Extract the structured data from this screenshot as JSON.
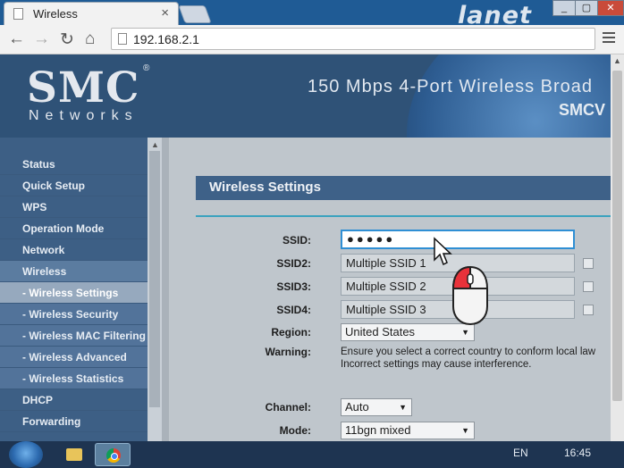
{
  "browser": {
    "tab_title": "Wireless",
    "tab_close": "×",
    "url": "192.168.2.1",
    "brand_watermark": "lanet",
    "nav": {
      "back": "←",
      "forward": "→",
      "reload": "↻",
      "home": "⌂"
    }
  },
  "header": {
    "logo": "SMC",
    "logo_reg": "®",
    "logo_sub": "Networks",
    "title": "150 Mbps 4-Port Wireless Broad",
    "model": "SMCV"
  },
  "sidebar": {
    "items": [
      {
        "label": "Status"
      },
      {
        "label": "Quick Setup"
      },
      {
        "label": "WPS"
      },
      {
        "label": "Operation Mode"
      },
      {
        "label": "Network"
      },
      {
        "label": "Wireless"
      },
      {
        "label": "- Wireless Settings"
      },
      {
        "label": "- Wireless Security"
      },
      {
        "label": "- Wireless MAC Filtering"
      },
      {
        "label": "- Wireless Advanced"
      },
      {
        "label": "- Wireless Statistics"
      },
      {
        "label": "DHCP"
      },
      {
        "label": "Forwarding"
      }
    ]
  },
  "main": {
    "section_title": "Wireless Settings",
    "ssid_label": "SSID:",
    "ssid_value": "●●●●●",
    "ssid2_label": "SSID2:",
    "ssid2_value": "Multiple SSID 1",
    "ssid3_label": "SSID3:",
    "ssid3_value": "Multiple SSID 2",
    "ssid4_label": "SSID4:",
    "ssid4_value": "Multiple SSID 3",
    "region_label": "Region:",
    "region_value": "United States",
    "warning_label": "Warning:",
    "warning_line1": "Ensure you select a correct country to conform local law",
    "warning_line2": "Incorrect settings may cause interference.",
    "channel_label": "Channel:",
    "channel_value": "Auto",
    "mode_label": "Mode:",
    "mode_value": "11bgn mixed"
  },
  "taskbar": {
    "language": "EN",
    "clock": "16:45"
  },
  "colors": {
    "header_bg": "#2f5277",
    "sidebar_bg": "#3d5f85",
    "active_item": "#96a9be",
    "section_head": "#3e6188",
    "accent_rule": "#3aa2bf",
    "focus_border": "#2f8fd4"
  },
  "icons": [
    "page-icon",
    "back-icon",
    "forward-icon",
    "reload-icon",
    "home-icon",
    "menu-icon",
    "mouse-pointer-icon",
    "mouse-click-icon",
    "windows-start-icon",
    "file-explorer-icon",
    "chrome-icon"
  ]
}
